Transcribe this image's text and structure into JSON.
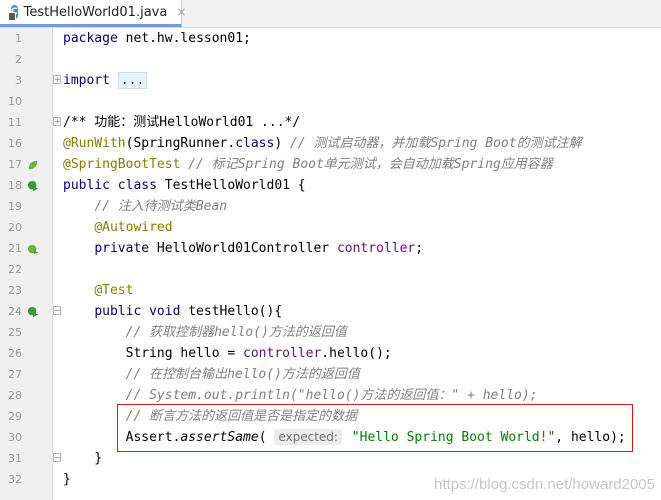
{
  "tab": {
    "title": "TestHelloWorld01.java",
    "close": "×",
    "icon_letter": "C"
  },
  "lines": [
    {
      "n": "1",
      "gutter": "",
      "fold": "",
      "tokens": [
        {
          "t": "package",
          "c": "kw"
        },
        {
          "t": " net.hw.lesson01;",
          "c": ""
        }
      ]
    },
    {
      "n": "2",
      "gutter": "",
      "fold": "",
      "tokens": []
    },
    {
      "n": "3",
      "gutter": "",
      "fold": "+",
      "tokens": [
        {
          "t": "import",
          "c": "kw"
        },
        {
          "t": " ",
          "c": ""
        },
        {
          "t": "...",
          "c": "pill"
        }
      ]
    },
    {
      "n": "10",
      "gutter": "",
      "fold": "",
      "tokens": []
    },
    {
      "n": "11",
      "gutter": "",
      "fold": "+",
      "tokens": [
        {
          "t": "/** 功能：测试HelloWorld01 ...*/",
          "c": "cm-plain"
        }
      ]
    },
    {
      "n": "16",
      "gutter": "",
      "fold": "",
      "tokens": [
        {
          "t": "@RunWith",
          "c": "ann"
        },
        {
          "t": "(SpringRunner.",
          "c": ""
        },
        {
          "t": "class",
          "c": "kw"
        },
        {
          "t": ") ",
          "c": ""
        },
        {
          "t": "// 测试启动器，并加载Spring Boot的测试注解",
          "c": "cm"
        }
      ]
    },
    {
      "n": "17",
      "gutter": "leaf",
      "fold": "",
      "tokens": [
        {
          "t": "@SpringBootTest",
          "c": "ann"
        },
        {
          "t": " ",
          "c": ""
        },
        {
          "t": "// 标记Spring Boot单元测试，会自动加载Spring应用容器",
          "c": "cm"
        }
      ]
    },
    {
      "n": "18",
      "gutter": "run",
      "fold": "",
      "tokens": [
        {
          "t": "public class",
          "c": "kw"
        },
        {
          "t": " TestHelloWorld01 {",
          "c": ""
        }
      ]
    },
    {
      "n": "19",
      "gutter": "",
      "fold": "",
      "tokens": [
        {
          "t": "    ",
          "c": ""
        },
        {
          "t": "// 注入待测试类Bean",
          "c": "cm"
        }
      ]
    },
    {
      "n": "20",
      "gutter": "",
      "fold": "",
      "tokens": [
        {
          "t": "    ",
          "c": ""
        },
        {
          "t": "@Autowired",
          "c": "ann"
        }
      ]
    },
    {
      "n": "21",
      "gutter": "bean",
      "fold": "",
      "tokens": [
        {
          "t": "    ",
          "c": ""
        },
        {
          "t": "private",
          "c": "kw"
        },
        {
          "t": " HelloWorld01Controller ",
          "c": ""
        },
        {
          "t": "controller",
          "c": "fld"
        },
        {
          "t": ";",
          "c": ""
        }
      ]
    },
    {
      "n": "22",
      "gutter": "",
      "fold": "",
      "tokens": []
    },
    {
      "n": "23",
      "gutter": "",
      "fold": "",
      "tokens": [
        {
          "t": "    ",
          "c": ""
        },
        {
          "t": "@Test",
          "c": "ann"
        }
      ]
    },
    {
      "n": "24",
      "gutter": "run",
      "fold": "-",
      "tokens": [
        {
          "t": "    ",
          "c": ""
        },
        {
          "t": "public void",
          "c": "kw"
        },
        {
          "t": " testHello(){",
          "c": ""
        }
      ]
    },
    {
      "n": "25",
      "gutter": "",
      "fold": "",
      "tokens": [
        {
          "t": "        ",
          "c": ""
        },
        {
          "t": "// 获取控制器hello()方法的返回值",
          "c": "cm"
        }
      ]
    },
    {
      "n": "26",
      "gutter": "",
      "fold": "",
      "tokens": [
        {
          "t": "        String hello = ",
          "c": ""
        },
        {
          "t": "controller",
          "c": "fld"
        },
        {
          "t": ".hello();",
          "c": ""
        }
      ]
    },
    {
      "n": "27",
      "gutter": "",
      "fold": "",
      "tokens": [
        {
          "t": "        ",
          "c": ""
        },
        {
          "t": "// 在控制台输出hello()方法的返回值",
          "c": "cm"
        }
      ]
    },
    {
      "n": "28",
      "gutter": "",
      "fold": "",
      "tokens": [
        {
          "t": "        ",
          "c": ""
        },
        {
          "t": "// System.out.println(\"hello()方法的返回值：\" + hello);",
          "c": "cm"
        }
      ]
    },
    {
      "n": "29",
      "gutter": "",
      "fold": "",
      "tokens": [
        {
          "t": "        ",
          "c": ""
        },
        {
          "t": "// 断言方法的返回值是否是指定的数据",
          "c": "cm"
        }
      ]
    },
    {
      "n": "30",
      "gutter": "",
      "fold": "",
      "tokens": [
        {
          "t": "        Assert.",
          "c": ""
        },
        {
          "t": "assertSame",
          "c": "it"
        },
        {
          "t": "( ",
          "c": ""
        },
        {
          "t": "expected:",
          "c": "hint"
        },
        {
          "t": " ",
          "c": ""
        },
        {
          "t": "\"Hello Spring Boot World!\"",
          "c": "str"
        },
        {
          "t": ", hello);",
          "c": ""
        }
      ]
    },
    {
      "n": "31",
      "gutter": "",
      "fold": "-",
      "tokens": [
        {
          "t": "    }",
          "c": ""
        }
      ]
    },
    {
      "n": "32",
      "gutter": "",
      "fold": "",
      "tokens": [
        {
          "t": "}",
          "c": ""
        }
      ]
    }
  ],
  "watermark": "https://blog.csdn.net/howard2005"
}
